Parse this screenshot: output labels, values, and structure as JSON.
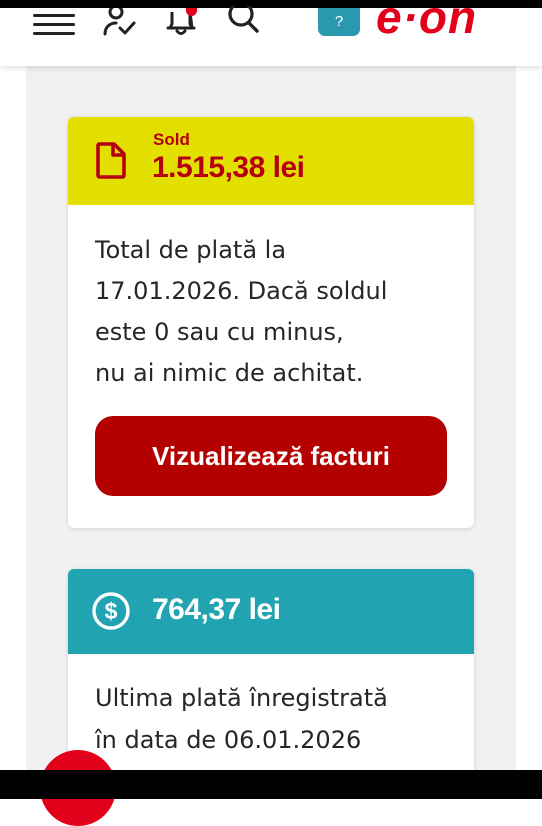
{
  "header": {
    "help_label": "?",
    "logo_text": "e·on",
    "icons": [
      "menu-icon",
      "user-check-icon",
      "bell-icon",
      "search-icon"
    ]
  },
  "balance_card": {
    "label": "Sold",
    "amount": "1.515,38 lei",
    "description_lines": [
      "Total de plată la",
      "17.01.2026. Dacă soldul",
      "este 0 sau cu minus,",
      "nu ai nimic de achitat."
    ],
    "button_label": "Vizualizează facturi",
    "icon": "document-icon"
  },
  "payment_card": {
    "amount": "764,37 lei",
    "description_lines": [
      "Ultima plată înregistrată",
      "în data de 06.01.2026"
    ],
    "icon": "dollar-circle-icon"
  },
  "colors": {
    "brand_red": "#e2001a",
    "balance_header": "#e3e000",
    "balance_text": "#b50012",
    "button": "#b50000",
    "payment_header": "#21a3b2"
  }
}
